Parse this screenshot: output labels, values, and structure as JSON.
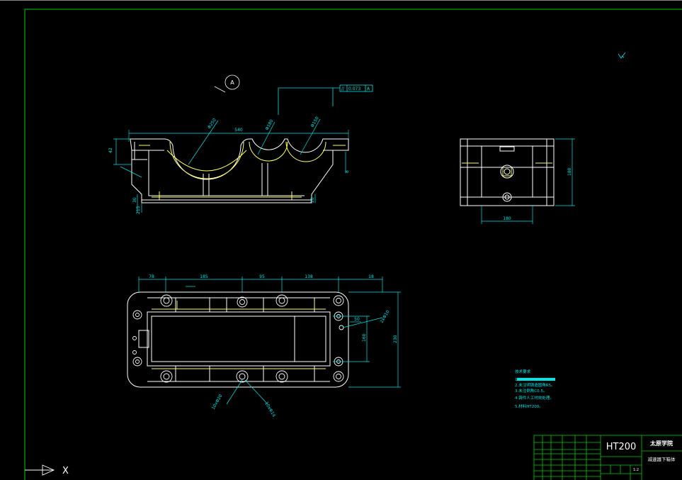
{
  "colors": {
    "background": "#000000",
    "frame": "#00cc00",
    "outline": "#ffffff",
    "highlight": "#ffff66",
    "dimension": "#00e5e5"
  },
  "front_view": {
    "datum_label": "A",
    "tolerance_symbol": "//",
    "tolerance_value": "0.073",
    "tolerance_datum": "A",
    "overall_length": "540",
    "bore_large": "Φ250",
    "bore_mid": "Φ180",
    "bore_small": "Φ150",
    "height_left": "42",
    "height_bottom": "30",
    "height_base": "215",
    "right_small": "8",
    "right_base": "20"
  },
  "side_view": {
    "height": "180",
    "width": "180"
  },
  "top_view": {
    "dim_1": "78",
    "dim_2": "185",
    "dim_3": "95",
    "dim_4": "138",
    "dim_5": "18",
    "dim_hole_pos": "50",
    "dim_inner_height": "160",
    "dim_outer_height": "230",
    "dim_hole_spec": "2xΦ10",
    "dim_hole_left": "10xΦ20",
    "dim_hole_right": "10xΦ14"
  },
  "notes": {
    "title": "技术要求",
    "lines": [
      "1.",
      "2.未注明铸造圆角R5。",
      "3.未注倒角C0.5。",
      "4.铸件人工时效处理。",
      "5.材料HT200。"
    ]
  },
  "title_block": {
    "material": "HT200",
    "school": "太原学院",
    "part_name": "减速器下箱体",
    "scale": "1:2"
  },
  "ucs": {
    "x_label": "X"
  }
}
